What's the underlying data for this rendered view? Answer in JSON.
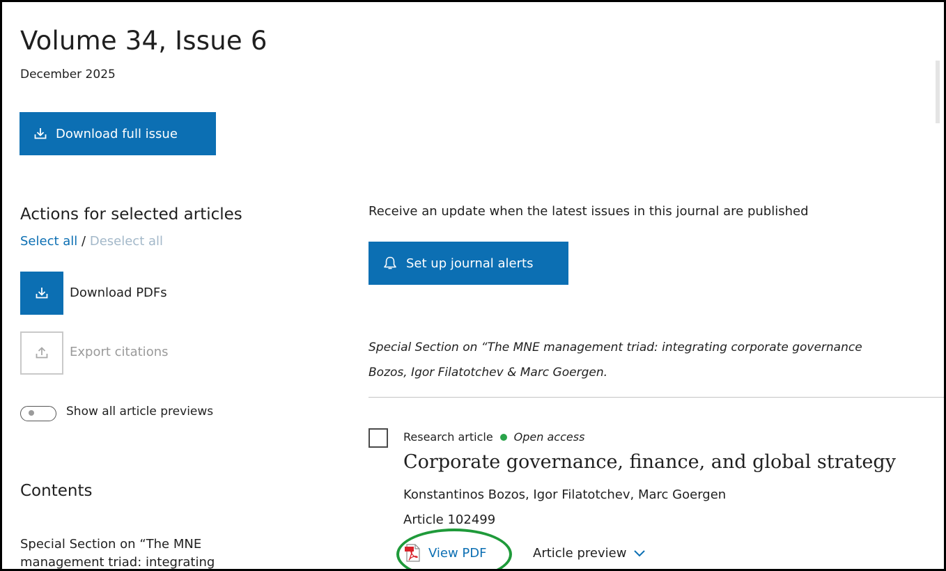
{
  "issue": {
    "title": "Volume 34, Issue 6",
    "date": "December 2025",
    "download_full_label": "Download full issue"
  },
  "actions": {
    "heading": "Actions for selected articles",
    "select_all": "Select all",
    "separator": "/",
    "deselect_all": "Deselect all",
    "download_pdfs": "Download PDFs",
    "export_citations": "Export citations",
    "show_previews": "Show all article previews",
    "show_previews_on": false
  },
  "contents": {
    "heading": "Contents",
    "first_item": "Special Section on “The MNE management triad: integrating"
  },
  "alerts": {
    "prompt": "Receive an update when the latest issues in this journal are published",
    "button_label": "Set up journal alerts"
  },
  "section": {
    "line1": "Special Section on “The MNE management triad: integrating corporate governance",
    "line2": "Bozos, Igor Filatotchev & Marc Goergen."
  },
  "article": {
    "type": "Research article",
    "access": "Open access",
    "title": "Corporate governance, finance, and global strategy",
    "authors": "Konstantinos Bozos, Igor Filatotchev, Marc Goergen",
    "number": "Article 102499",
    "view_pdf": "View PDF",
    "preview": "Article preview"
  },
  "colors": {
    "primary": "#0c6fb3",
    "open_access_dot": "#2aa34a",
    "highlight_ring": "#1f9a3a"
  },
  "icons": [
    "download-icon",
    "upload-icon",
    "bell-icon",
    "pdf-icon",
    "chevron-down-icon"
  ]
}
